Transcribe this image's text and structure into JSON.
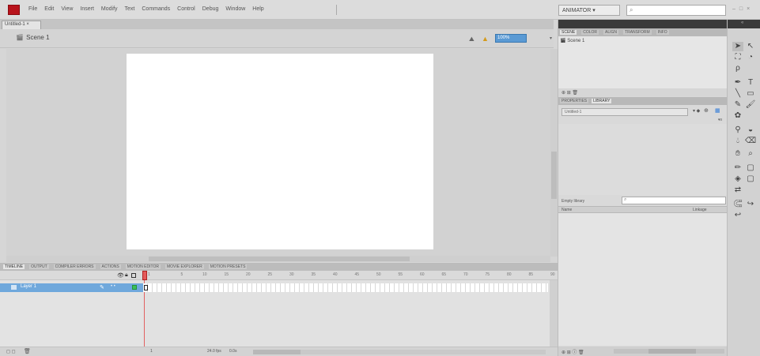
{
  "menu": [
    "File",
    "Edit",
    "View",
    "Insert",
    "Modify",
    "Text",
    "Commands",
    "Control",
    "Debug",
    "Window",
    "Help"
  ],
  "workspace": "ANIMATOR ▾",
  "doc_tab": "Untitled-1 ×",
  "scene": "Scene 1",
  "zoom": "100%",
  "panel_tabs": [
    {
      "label": "TIMELINE",
      "active": true
    },
    {
      "label": "OUTPUT",
      "active": false
    },
    {
      "label": "COMPILER ERRORS",
      "active": false
    },
    {
      "label": "ACTIONS",
      "active": false
    },
    {
      "label": "MOTION EDITOR",
      "active": false
    },
    {
      "label": "MOVIE EXPLORER",
      "active": false
    },
    {
      "label": "MOTION PRESETS",
      "active": false
    }
  ],
  "frame_numbers": [
    "1",
    "5",
    "10",
    "15",
    "20",
    "25",
    "30",
    "35",
    "40",
    "45",
    "50",
    "55",
    "60",
    "65",
    "70",
    "75",
    "80",
    "85",
    "90"
  ],
  "layer": {
    "name": "Layer 1",
    "status": "•  •"
  },
  "timeline_status": {
    "frame": "1",
    "fps": "24.0 fps",
    "time": "0.0s"
  },
  "top_tabs": [
    {
      "label": "SCENE",
      "active": true
    },
    {
      "label": "COLOR",
      "active": false
    },
    {
      "label": "ALIGN",
      "active": false
    },
    {
      "label": "TRANSFORM",
      "active": false
    },
    {
      "label": "INFO",
      "active": false
    }
  ],
  "scene_list_item": "Scene 1",
  "lib_tabs": [
    {
      "label": "PROPERTIES",
      "active": false
    },
    {
      "label": "LIBRARY",
      "active": true
    }
  ],
  "library": {
    "doc_select": "Untitled-1",
    "search_label": "Empty library",
    "col_name": "Name",
    "col_linkage": "Linkage"
  }
}
